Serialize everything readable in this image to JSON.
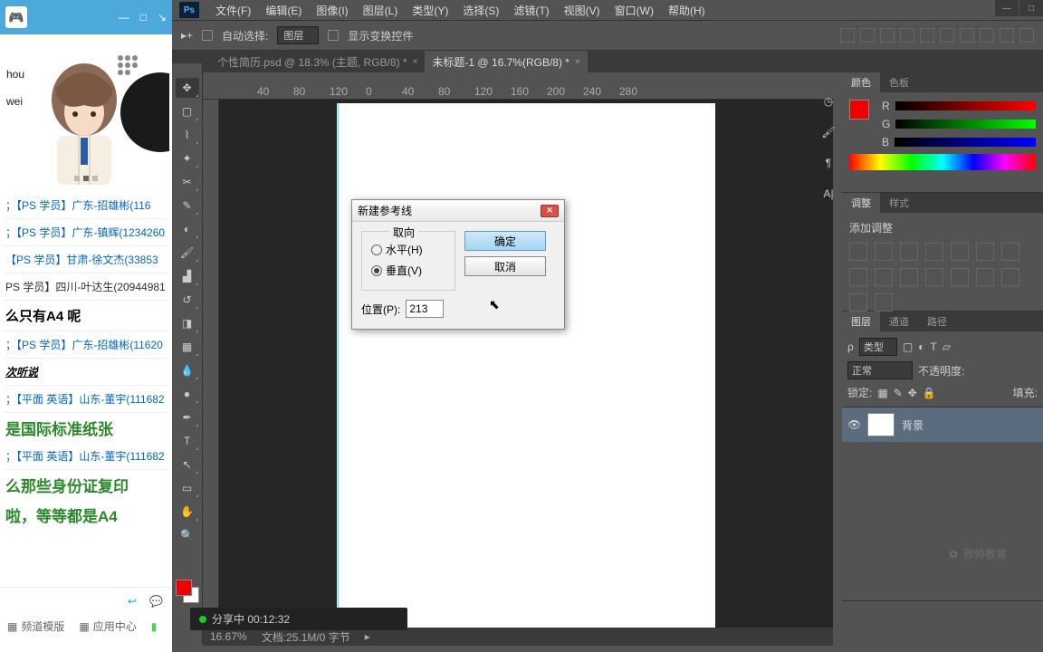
{
  "left": {
    "chat": [
      {
        "t": "；【PS  学员】广东-招雄彬(116",
        "cls": ""
      },
      {
        "t": "；【PS  学员】广东-镇辉(1234260",
        "cls": ""
      },
      {
        "t": "【PS  学员】甘肃-徐文杰(33853",
        "cls": ""
      },
      {
        "t": "PS  学员】四川-叶达生(20944981",
        "cls": "gray"
      },
      {
        "t": "么只有A4 呢",
        "cls": "gray",
        "big": false,
        "black": true
      },
      {
        "t": "；【PS  学员】广东-招雄彬(11620",
        "cls": ""
      },
      {
        "t": "次听说",
        "cls": "chat-italic"
      },
      {
        "t": "；【平面 英语】山东-董宇(111682",
        "cls": ""
      },
      {
        "t": "是国际标准纸张",
        "cls": "chat-big"
      },
      {
        "t": "；【平面 英语】山东-董宇(111682",
        "cls": ""
      },
      {
        "t": "么那些身份证复印",
        "cls": "chat-big"
      },
      {
        "t": "啦，等等都是A4",
        "cls": "chat-big"
      }
    ],
    "bottom_tabs": {
      "a": "频道模版",
      "b": "应用中心"
    }
  },
  "menu": [
    "文件(F)",
    "编辑(E)",
    "图像(I)",
    "图层(L)",
    "类型(Y)",
    "选择(S)",
    "滤镜(T)",
    "视图(V)",
    "窗口(W)",
    "帮助(H)"
  ],
  "options": {
    "auto": "自动选择:",
    "layer": "图层",
    "transform": "显示变换控件"
  },
  "tabs": [
    {
      "label": "个性简历.psd @ 18.3% (主题, RGB/8) *",
      "active": false
    },
    {
      "label": "未标题-1 @ 16.7%(RGB/8) *",
      "active": true
    }
  ],
  "ruler": [
    "0",
    "40",
    "80",
    "120",
    "160",
    "200",
    "240",
    "280"
  ],
  "ruler_neg": [
    "120",
    "80",
    "40"
  ],
  "dialog": {
    "title": "新建参考线",
    "orientation": "取向",
    "horizontal": "水平(H)",
    "vertical": "垂直(V)",
    "position_label": "位置(P):",
    "position_value": "213",
    "ok": "确定",
    "cancel": "取消"
  },
  "panels": {
    "color": {
      "tab1": "颜色",
      "tab2": "色板"
    },
    "adjust": {
      "tab1": "调整",
      "tab2": "样式",
      "label": "添加调整"
    },
    "layers": {
      "tab1": "图层",
      "tab2": "通道",
      "tab3": "路径",
      "type": "类型",
      "normal": "正常",
      "opacity": "不透明度:",
      "lock": "锁定:",
      "fill": "填充:",
      "bg": "背景"
    }
  },
  "status": {
    "zoom": "16.67%",
    "doc": "文档:25.1M/0 字节"
  },
  "share": {
    "text": "分享中 00:12:32"
  },
  "watermark": "邢帅教育"
}
